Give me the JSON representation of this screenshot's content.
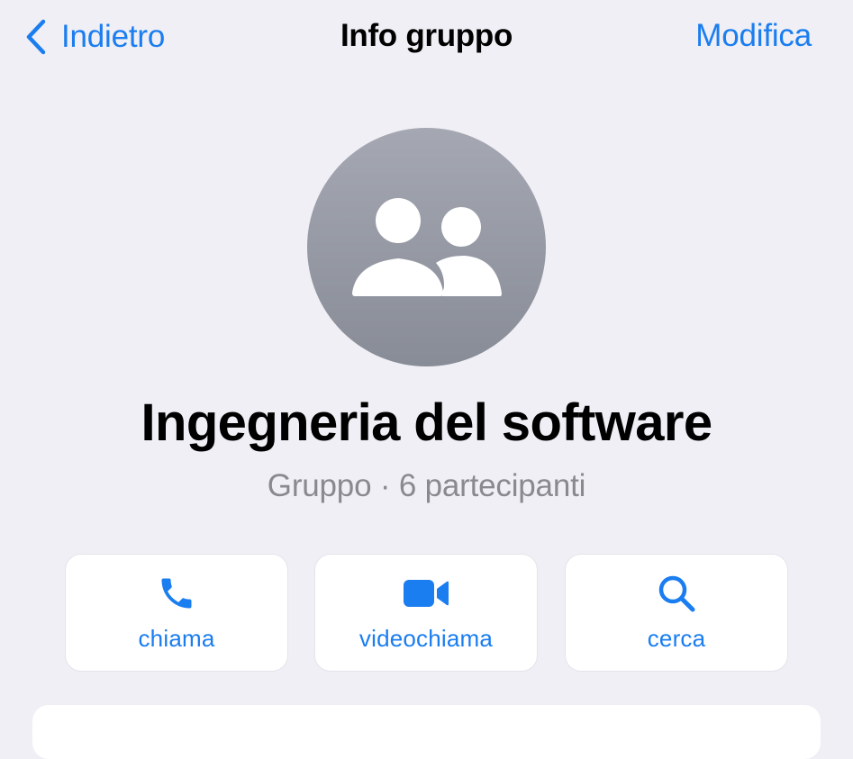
{
  "navbar": {
    "back_label": "Indietro",
    "title": "Info gruppo",
    "edit_label": "Modifica"
  },
  "group": {
    "avatar_icon": "group-icon",
    "name": "Ingegneria del software",
    "meta": "Gruppo · 6 partecipanti"
  },
  "actions": [
    {
      "icon": "phone-icon",
      "label": "chiama"
    },
    {
      "icon": "video-camera-icon",
      "label": "videochiama"
    },
    {
      "icon": "search-icon",
      "label": "cerca"
    }
  ],
  "colors": {
    "background": "#f0eff5",
    "accent": "#1a7df0",
    "card": "#ffffff",
    "secondary_text": "#8a8a8e",
    "avatar": "#9a9da6"
  }
}
